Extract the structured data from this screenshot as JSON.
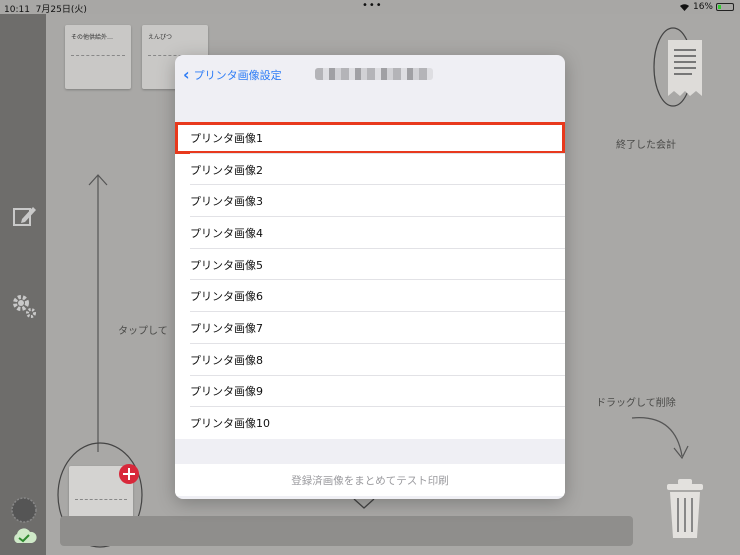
{
  "status_bar": {
    "time": "10:11",
    "date": "7月25日(火)",
    "more": "•••",
    "battery": "16%"
  },
  "cards": [
    {
      "title": "その他供給外…"
    },
    {
      "title": "えんぴつ"
    }
  ],
  "hints": {
    "tap": "タップして",
    "finished": "終了した会計",
    "drag": "ドラッグして削除"
  },
  "modal": {
    "back_label": "プリンタ画像設定",
    "items": [
      "プリンタ画像1",
      "プリンタ画像2",
      "プリンタ画像3",
      "プリンタ画像4",
      "プリンタ画像5",
      "プリンタ画像6",
      "プリンタ画像7",
      "プリンタ画像8",
      "プリンタ画像9",
      "プリンタ画像10"
    ],
    "selected_index": 0,
    "footer_button": "登録済画像をまとめてテスト印刷"
  },
  "colors": {
    "accent_blue": "#2d7cf6",
    "highlight_red": "#e8391d",
    "add_badge_red": "#d8283a"
  }
}
